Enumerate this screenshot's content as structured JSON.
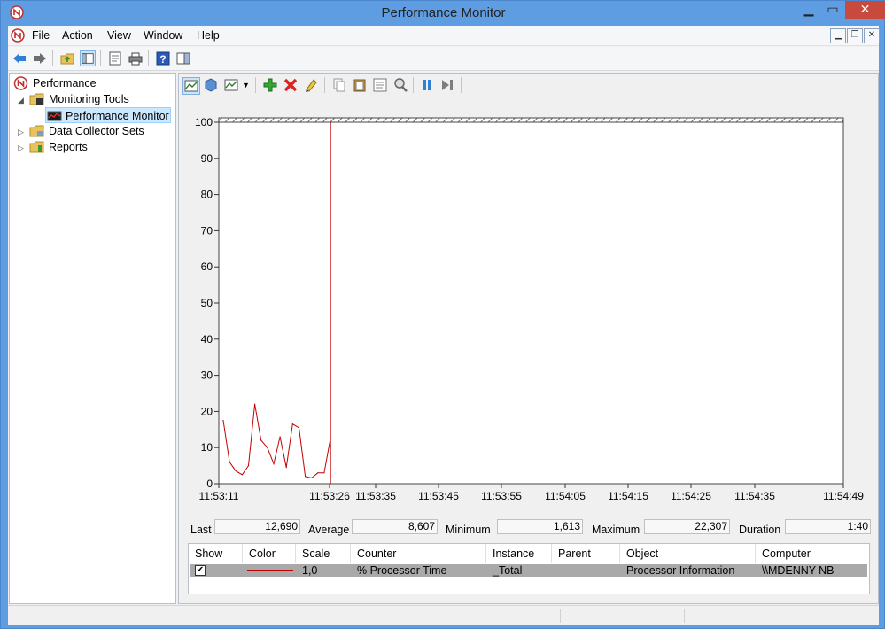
{
  "window": {
    "title": "Performance Monitor"
  },
  "menu": {
    "items": [
      "File",
      "Action",
      "View",
      "Window",
      "Help"
    ]
  },
  "tree": {
    "root": "Performance",
    "monitoring_tools": "Monitoring Tools",
    "performance_monitor": "Performance Monitor",
    "data_collector_sets": "Data Collector Sets",
    "reports": "Reports"
  },
  "stats": {
    "last_label": "Last",
    "last_value": "12,690",
    "average_label": "Average",
    "average_value": "8,607",
    "minimum_label": "Minimum",
    "minimum_value": "1,613",
    "maximum_label": "Maximum",
    "maximum_value": "22,307",
    "duration_label": "Duration",
    "duration_value": "1:40"
  },
  "counters": {
    "headers": [
      "Show",
      "Color",
      "Scale",
      "Counter",
      "Instance",
      "Parent",
      "Object",
      "Computer"
    ],
    "rows": [
      {
        "show": true,
        "color": "#c00000",
        "scale": "1,0",
        "counter": "% Processor Time",
        "instance": "_Total",
        "parent": "---",
        "object": "Processor Information",
        "computer": "\\\\MDENNY-NB"
      }
    ]
  },
  "chart_data": {
    "type": "line",
    "xlabel": "",
    "ylabel": "",
    "ylim": [
      0,
      100
    ],
    "y_ticks": [
      0,
      10,
      20,
      30,
      40,
      50,
      60,
      70,
      80,
      90,
      100
    ],
    "x_tick_labels": [
      "11:53:11",
      "11:53:26",
      "11:53:35",
      "11:53:45",
      "11:53:55",
      "11:54:05",
      "11:54:15",
      "11:54:25",
      "11:54:35",
      "11:54:49"
    ],
    "grid": false,
    "line_color": "#c00000",
    "series": [
      {
        "values": [
          17.5,
          6,
          3.5,
          2.5,
          5,
          22,
          12,
          10,
          5.5,
          13,
          4.5,
          16.5,
          15.5,
          2,
          1.6,
          3,
          3,
          12.7
        ]
      }
    ],
    "sample_interval_seconds": 1,
    "current_time_index": 17
  }
}
